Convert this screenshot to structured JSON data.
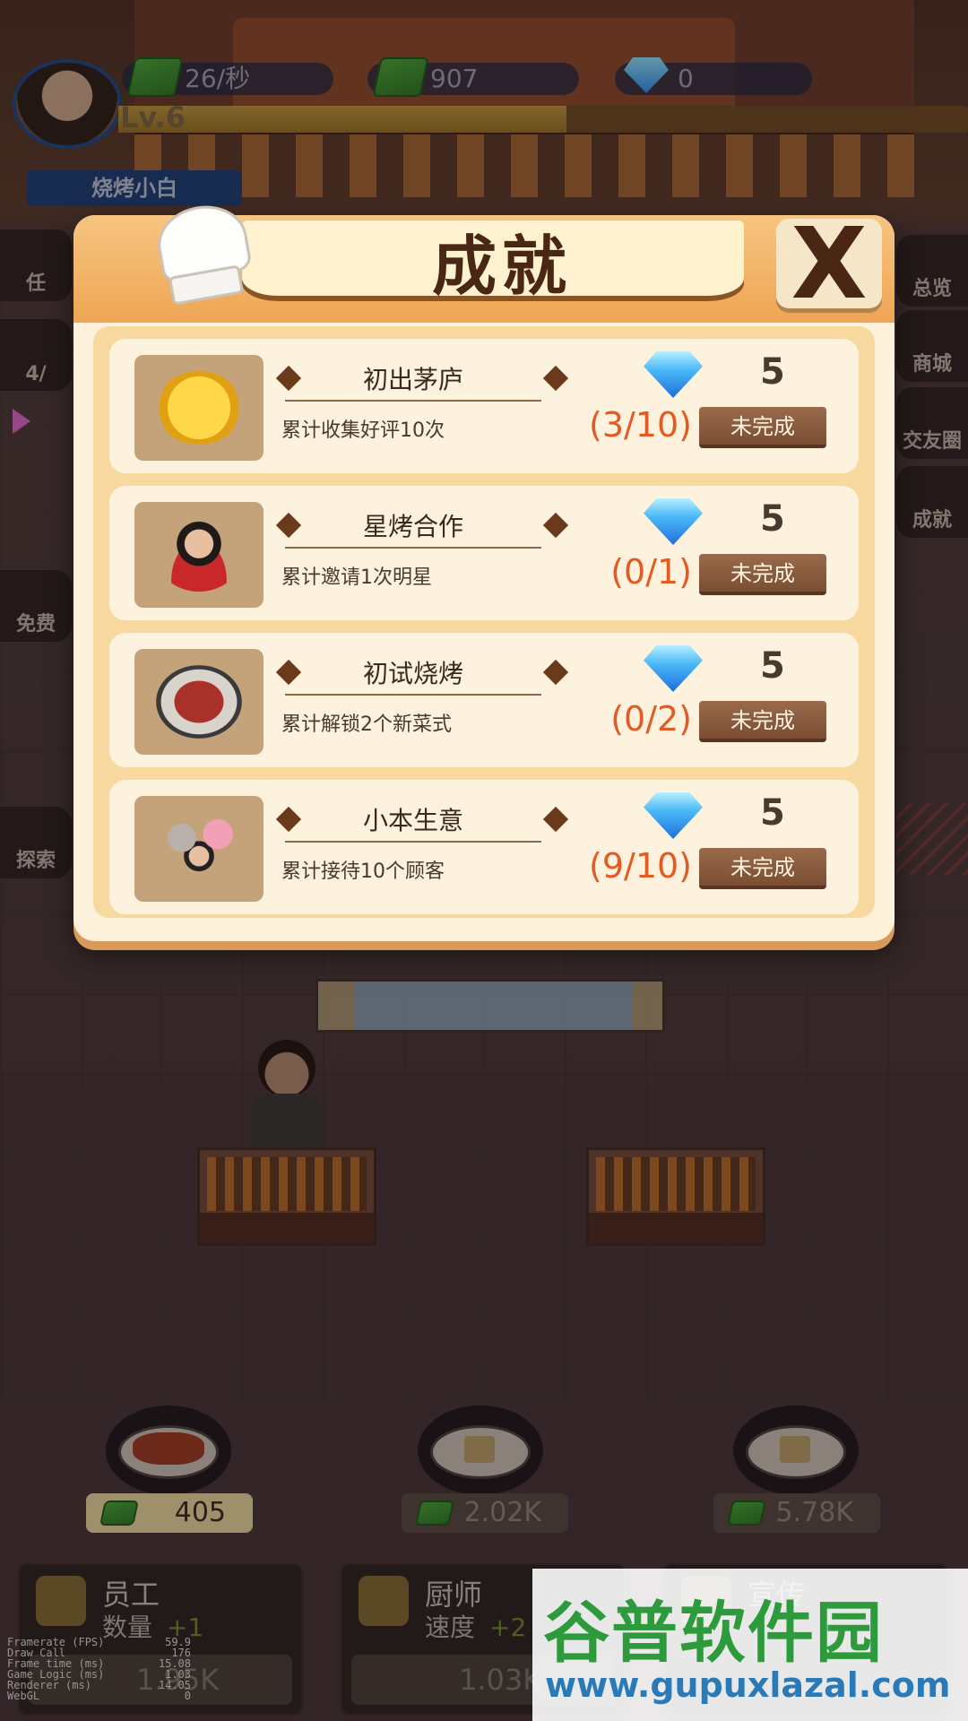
{
  "hud": {
    "income_rate": "26/秒",
    "money": "907",
    "gems": "0",
    "level": "Lv.6",
    "player_title": "烧烤小白"
  },
  "side_buttons": {
    "left": [
      "任",
      "4/",
      "免费",
      "探索"
    ],
    "right": [
      "总览",
      "商城",
      "交友圈",
      "成就"
    ]
  },
  "modal": {
    "title": "成就",
    "close_label": "X",
    "achievements": [
      {
        "name": "初出茅庐",
        "desc": "累计收集好评10次",
        "progress": "(3/10)",
        "reward": "5",
        "status": "未完成"
      },
      {
        "name": "星烤合作",
        "desc": "累计邀请1次明星",
        "progress": "(0/1)",
        "reward": "5",
        "status": "未完成"
      },
      {
        "name": "初试烧烤",
        "desc": "累计解锁2个新菜式",
        "progress": "(0/2)",
        "reward": "5",
        "status": "未完成"
      },
      {
        "name": "小本生意",
        "desc": "累计接待10个顾客",
        "progress": "(9/10)",
        "reward": "5",
        "status": "未完成"
      }
    ]
  },
  "dishes": [
    {
      "price": "405"
    },
    {
      "price": "2.02K"
    },
    {
      "price": "5.78K"
    }
  ],
  "bottom_panels": [
    {
      "label": "员工",
      "sub": "数量",
      "plus": "+1",
      "cost": "1.95K"
    },
    {
      "label": "厨师",
      "sub": "速度",
      "plus": "+2",
      "cost": "1.03K"
    },
    {
      "label": "宣传",
      "sub": "",
      "plus": "",
      "cost": ""
    }
  ],
  "debug_stats": [
    {
      "k": "Framerate (FPS)",
      "v": "59.9"
    },
    {
      "k": "Draw Call",
      "v": "176"
    },
    {
      "k": "Frame time (ms)",
      "v": "15.08"
    },
    {
      "k": "Game Logic (ms)",
      "v": "1.03"
    },
    {
      "k": "Renderer (ms)",
      "v": "14.05"
    },
    {
      "k": "WebGL",
      "v": "0"
    }
  ],
  "watermark": {
    "brand": "谷普软件园",
    "url": "www.gupuxlazal.com"
  },
  "colors": {
    "progress_text": "#e35a22",
    "modal_header": "#eea554",
    "status_button": "#8a5a3e"
  }
}
